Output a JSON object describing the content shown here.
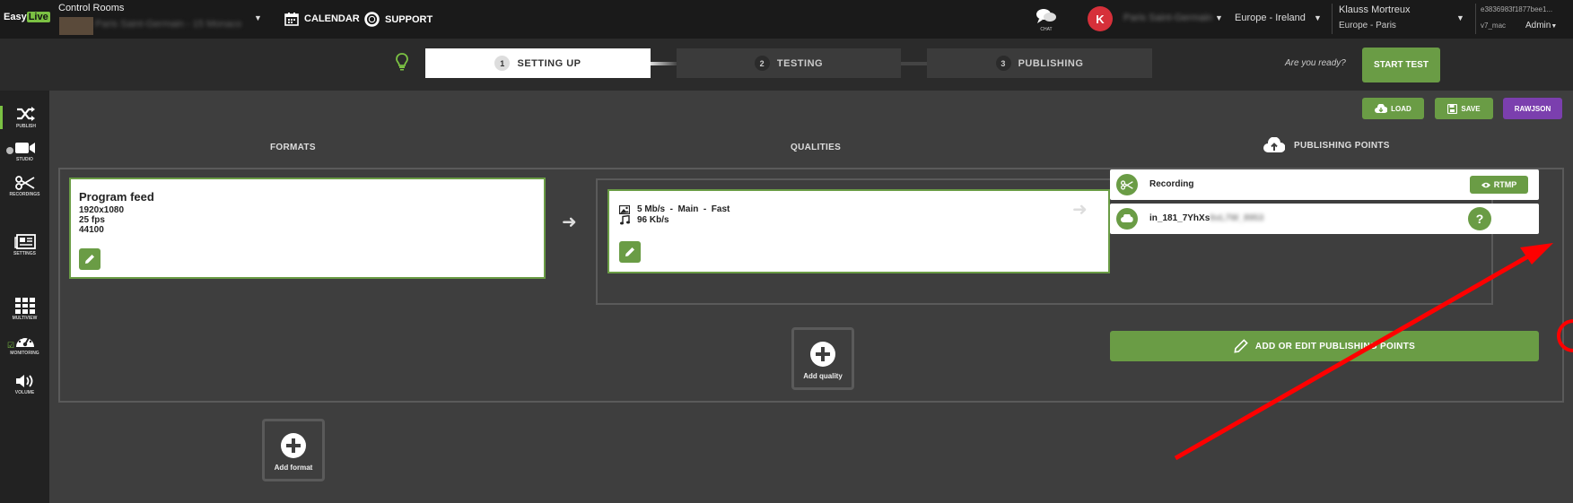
{
  "topbar": {
    "logo_easy": "Easy",
    "logo_live": "Live",
    "control_rooms_title": "Control Rooms",
    "room_name": "Paris Saint-Germain - 15 Monaco",
    "calendar_label": "CALENDAR",
    "support_label": "SUPPORT",
    "chat_label": "CHAT",
    "avatar_initial": "K",
    "user_blurred": "Paris Saint-Germain",
    "region": "Europe - Ireland",
    "user_name": "Klauss Mortreux",
    "timezone": "Europe - Paris",
    "session_hash": "e3836983f1877bee1...",
    "version": "v7_mac",
    "role": "Admin"
  },
  "steps": [
    {
      "number": "1",
      "label": "SETTING UP",
      "active": true
    },
    {
      "number": "2",
      "label": "TESTING",
      "active": false
    },
    {
      "number": "3",
      "label": "PUBLISHING",
      "active": false
    }
  ],
  "ready_text": "Are you ready?",
  "start_test_label": "START TEST",
  "sidebar": {
    "publish": "PUBLISH",
    "studio": "STUDIO",
    "recordings": "RECORDINGS",
    "settings": "SETTINGS",
    "multiview": "MULTIVIEW",
    "monitoring": "MONITORING",
    "volume": "VOLUME"
  },
  "toolbar": {
    "load_label": "LOAD",
    "save_label": "SAVE",
    "rawjson_label": "RAWJSON"
  },
  "columns": {
    "formats": "FORMATS",
    "qualities": "QUALITIES",
    "publishing_points": "PUBLISHING POINTS"
  },
  "format": {
    "title": "Program feed",
    "resolution": "1920x1080",
    "fps": "25 fps",
    "sample_rate": "44100"
  },
  "quality": {
    "video": "5 Mb/s  -  Main  -  Fast",
    "audio": "96 Kb/s"
  },
  "publishing_points": [
    {
      "label": "Recording",
      "badge": "RTMP"
    },
    {
      "label": "in_181_7YhXs",
      "label_blurred": "6vL7W_8953"
    }
  ],
  "add_pp_label": "ADD OR EDIT PUBLISHING POINTS",
  "add_quality_label": "Add quality",
  "add_format_label": "Add format",
  "colors": {
    "accent_green": "#6a9c45",
    "rawjson_purple": "#7b3fae",
    "annotation_red": "#ff0000"
  }
}
